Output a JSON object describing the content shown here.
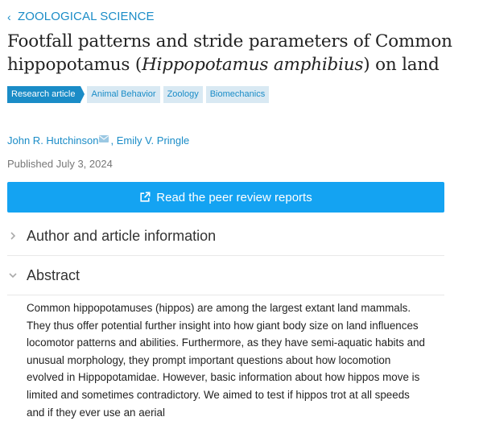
{
  "section_link": "ZOOLOGICAL SCIENCE",
  "article": {
    "title_pre": "Footfall patterns and stride parameters of Common hippopotamus (",
    "title_italic": "Hippopotamus amphibius",
    "title_post": ") on land",
    "tags": [
      "Research article",
      "Animal Behavior",
      "Zoology",
      "Biomechanics"
    ],
    "authors": [
      "John R. Hutchinson",
      "Emily V. Pringle"
    ],
    "published": "Published July 3, 2024",
    "review_button": "Read the peer review reports"
  },
  "accordion": {
    "author_info": "Author and article information",
    "abstract": "Abstract"
  },
  "abstract_text": "Common hippopotamuses (hippos) are among the largest extant land mammals. They thus offer potential further insight into how giant body size on land influences locomotor patterns and abilities. Furthermore, as they have semi-aquatic habits and unusual morphology, they prompt important questions about how locomotion evolved in Hippopotamidae. However, basic information about how hippos move is limited and sometimes contradictory. We aimed to test if hippos trot at all speeds and if they ever use an aerial",
  "colors": {
    "accent": "#1a8cc7",
    "button": "#14a3f2",
    "tag_bg": "#d9e9f3"
  },
  "icons": {
    "back": "chevron-left-icon",
    "mail": "mail-icon",
    "external": "external-link-icon",
    "collapsed": "chevron-right-icon",
    "expanded": "chevron-down-icon"
  }
}
